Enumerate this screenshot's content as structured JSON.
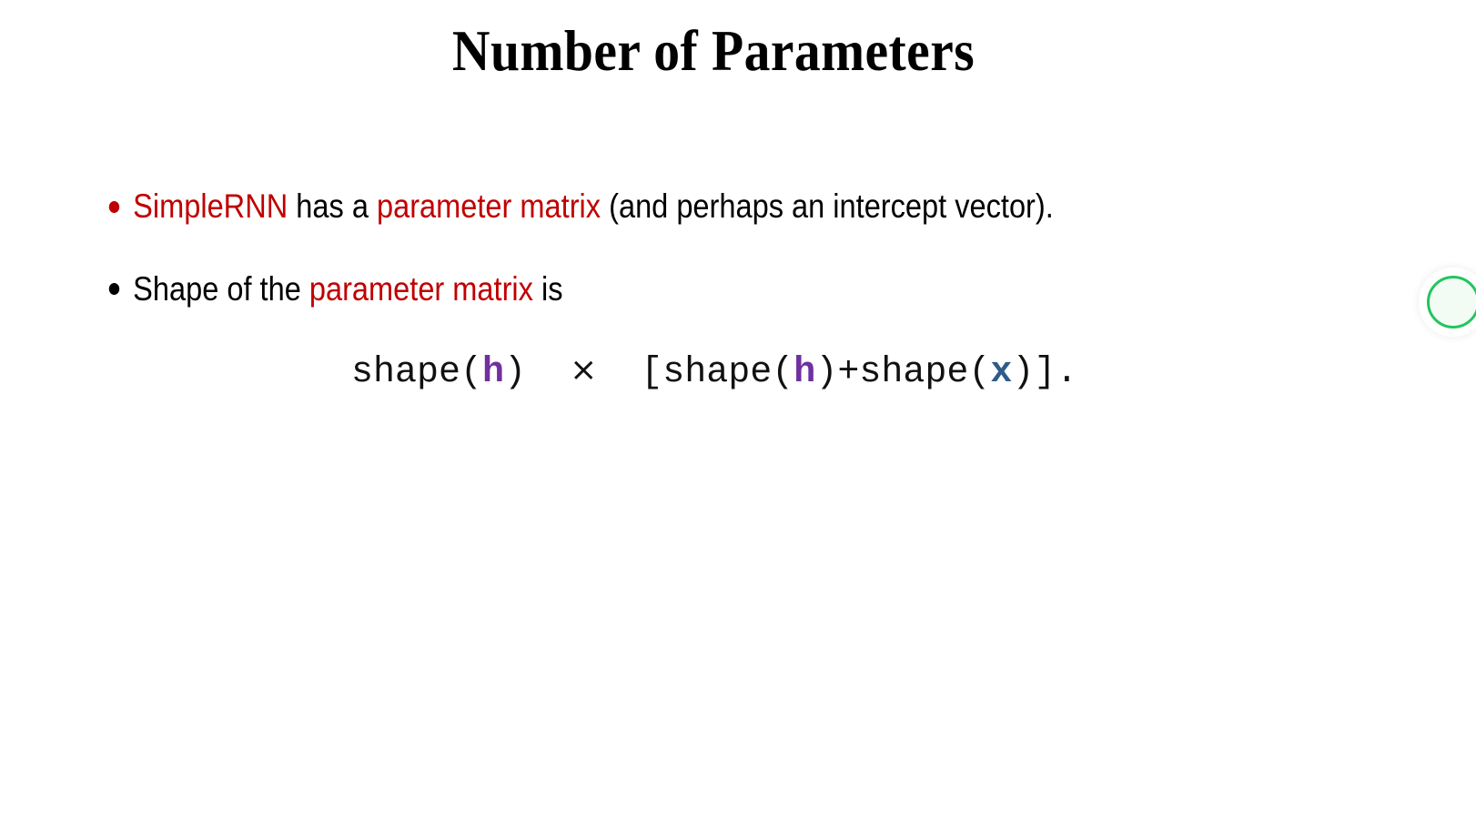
{
  "slide": {
    "title": "Number of Parameters",
    "background_color": "#FFFFFF"
  },
  "colors": {
    "accent_red": "#C00000",
    "text_black": "#000000",
    "symbol_h_purple": "#7030A0",
    "symbol_x_blue": "#2E5C8A",
    "status_green": "#22C55E"
  },
  "bullets": [
    {
      "marker_color": "#C00000",
      "segments": [
        {
          "text": "SimpleRNN",
          "color": "red"
        },
        {
          "text": " has a ",
          "color": "black"
        },
        {
          "text": "parameter matrix",
          "color": "red"
        },
        {
          "text": " (and perhaps an intercept vector).",
          "color": "black"
        }
      ],
      "plain_text": "SimpleRNN has a parameter matrix (and perhaps an intercept vector)."
    },
    {
      "marker_color": "#000000",
      "segments": [
        {
          "text": "Shape of the ",
          "color": "black"
        },
        {
          "text": "parameter matrix",
          "color": "red"
        },
        {
          "text": " is",
          "color": "black"
        }
      ],
      "plain_text": "Shape of the parameter matrix is"
    }
  ],
  "formula": {
    "plain_text": "shape(h) × [shape(h)+shape(x)].",
    "parts": {
      "p1": "shape(",
      "h1": "h",
      "p2": ")",
      "times": "×",
      "p3": "[shape(",
      "h2": "h",
      "p4": ")+shape(",
      "x1": "x",
      "p5": ")].",
      "gap": "  "
    }
  },
  "status_indicator": {
    "icon": "green-circle-indicator",
    "color": "#22C55E",
    "label": ""
  }
}
